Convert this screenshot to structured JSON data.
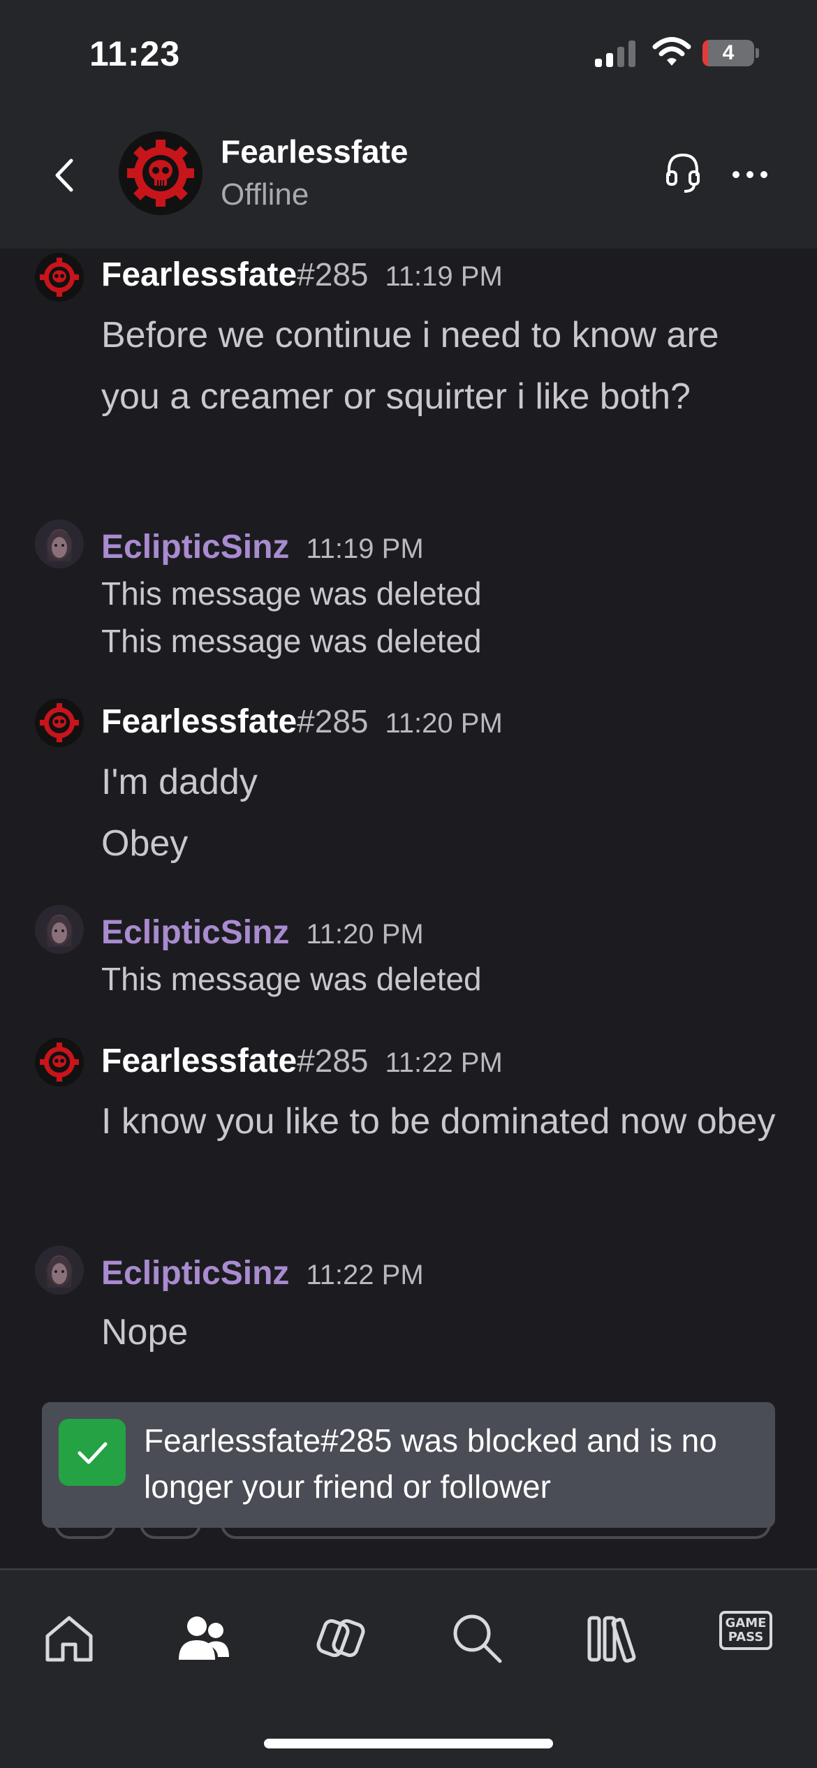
{
  "status_bar": {
    "time": "11:23",
    "battery_level": "4",
    "battery_fraction": 0.04
  },
  "header": {
    "name": "Fearlessfate",
    "status": "Offline"
  },
  "messages": [
    {
      "author": "Fearlessfate",
      "tag": "#285",
      "time": "11:19 PM",
      "lines": [
        "Before we continue i need to know are you a creamer or squirter i like both?"
      ]
    },
    {
      "author": "EclipticSinz",
      "tag": "",
      "time": "11:19 PM",
      "lines": [
        "This message was deleted",
        "This message was deleted"
      ]
    },
    {
      "author": "Fearlessfate",
      "tag": "#285",
      "time": "11:20 PM",
      "lines": [
        "I'm daddy",
        "Obey"
      ]
    },
    {
      "author": "EclipticSinz",
      "tag": "",
      "time": "11:20 PM",
      "lines": [
        "This message was deleted"
      ]
    },
    {
      "author": "Fearlessfate",
      "tag": "#285",
      "time": "11:22 PM",
      "lines": [
        "I know you like to be dominated now obey"
      ]
    },
    {
      "author": "EclipticSinz",
      "tag": "",
      "time": "11:22 PM",
      "lines": [
        "Nope"
      ]
    }
  ],
  "toast": {
    "text": "Fearlessfate#285 was blocked and is no longer your friend or follower"
  },
  "nav": {
    "items": [
      "home-icon",
      "people-icon",
      "social-icon",
      "search-icon",
      "library-icon",
      "game-pass-icon"
    ],
    "game_pass_line1": "GAME",
    "game_pass_line2": "PASS"
  },
  "colors": {
    "background": "#1c1c20",
    "header": "#25262a",
    "purple_author": "#a98bd0",
    "toast": "#4a4d55",
    "check_green": "#25a244"
  }
}
